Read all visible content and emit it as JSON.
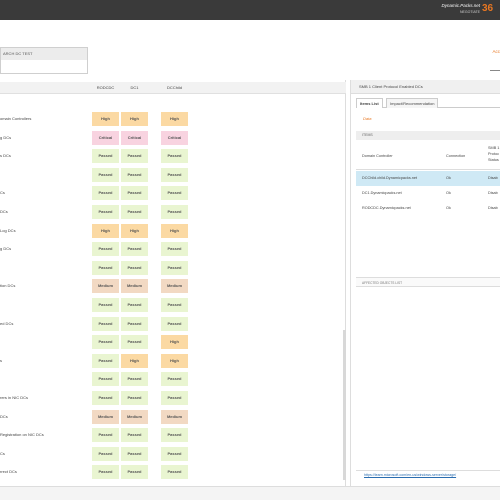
{
  "header": {
    "brand_name": "Dynamic.Packs.net",
    "brand_sub": "NEGOTIATE",
    "score": "36"
  },
  "search": {
    "title": "ARCH DC TEST",
    "value": ""
  },
  "top_right_link": "Acc",
  "grid": {
    "columns": [
      "RODCDC",
      "DC1",
      "DCChild"
    ],
    "rows": [
      {
        "label": "omain Controllers",
        "levels": [
          "High",
          "High",
          "High"
        ]
      },
      {
        "label": "g DCs",
        "levels": [
          "Critical",
          "Critical",
          "Critical"
        ]
      },
      {
        "label": "s DCs",
        "levels": [
          "Passed",
          "Passed",
          "Passed"
        ]
      },
      {
        "label": "",
        "levels": [
          "Passed",
          "Passed",
          "Passed"
        ]
      },
      {
        "label": "Cs",
        "levels": [
          "Passed",
          "Passed",
          "Passed"
        ]
      },
      {
        "label": "DCs",
        "levels": [
          "Passed",
          "Passed",
          "Passed"
        ]
      },
      {
        "label": "Log DCs",
        "levels": [
          "High",
          "High",
          "High"
        ]
      },
      {
        "label": "g DCs",
        "levels": [
          "Passed",
          "Passed",
          "Passed"
        ]
      },
      {
        "label": "",
        "levels": [
          "Passed",
          "Passed",
          "Passed"
        ]
      },
      {
        "label": "tion DCs",
        "levels": [
          "Medium",
          "Medium",
          "Medium"
        ]
      },
      {
        "label": "",
        "levels": [
          "Passed",
          "Passed",
          "Passed"
        ]
      },
      {
        "label": "ed DCs",
        "levels": [
          "Passed",
          "Passed",
          "Passed"
        ]
      },
      {
        "label": "",
        "levels": [
          "Passed",
          "Passed",
          "High"
        ]
      },
      {
        "label": "s",
        "levels": [
          "Passed",
          "High",
          "High"
        ]
      },
      {
        "label": "",
        "levels": [
          "Passed",
          "Passed",
          "Passed"
        ]
      },
      {
        "label": "rers in NIC DCs",
        "levels": [
          "Passed",
          "Passed",
          "Passed"
        ]
      },
      {
        "label": "DCs",
        "levels": [
          "Medium",
          "Medium",
          "Medium"
        ]
      },
      {
        "label": "Registration on NIC DCs",
        "levels": [
          "Passed",
          "Passed",
          "Passed"
        ]
      },
      {
        "label": "Cs",
        "levels": [
          "Passed",
          "Passed",
          "Passed"
        ]
      },
      {
        "label": "rrect DCs",
        "levels": [
          "Passed",
          "Passed",
          "Passed"
        ]
      }
    ]
  },
  "colors": {
    "High": "#fbd9a3",
    "Critical": "#f8d3e0",
    "Passed": "#e9f5d1",
    "Medium": "#f2d9c3",
    "accent": "#e87722"
  },
  "right_panel": {
    "title": "SMB 1 Client Protocol Enabled DCs",
    "tabs": [
      "Items List",
      "Impact/Recommendation"
    ],
    "data_link": "Data",
    "items_label": "ITEMS",
    "table_headers": {
      "controller": "Domain Controller",
      "connection": "Connection",
      "smb_line1": "SMB 1",
      "smb_line2": "Protoc",
      "smb_line3": "Status"
    },
    "table_rows": [
      {
        "controller": "DCChild.child.Dynamicpacks.net",
        "connection": "Ok",
        "status": "Disab"
      },
      {
        "controller": "DC1.Dynamicpacks.net",
        "connection": "Ok",
        "status": "Disab"
      },
      {
        "controller": "RODCDC.Dynamicpacks.net",
        "connection": "Ok",
        "status": "Disab"
      }
    ],
    "affected_label": "AFFECTED OBJECTS LIST",
    "reference_link": "https://learn.microsoft.com/en-us/windows-server/storage/"
  }
}
